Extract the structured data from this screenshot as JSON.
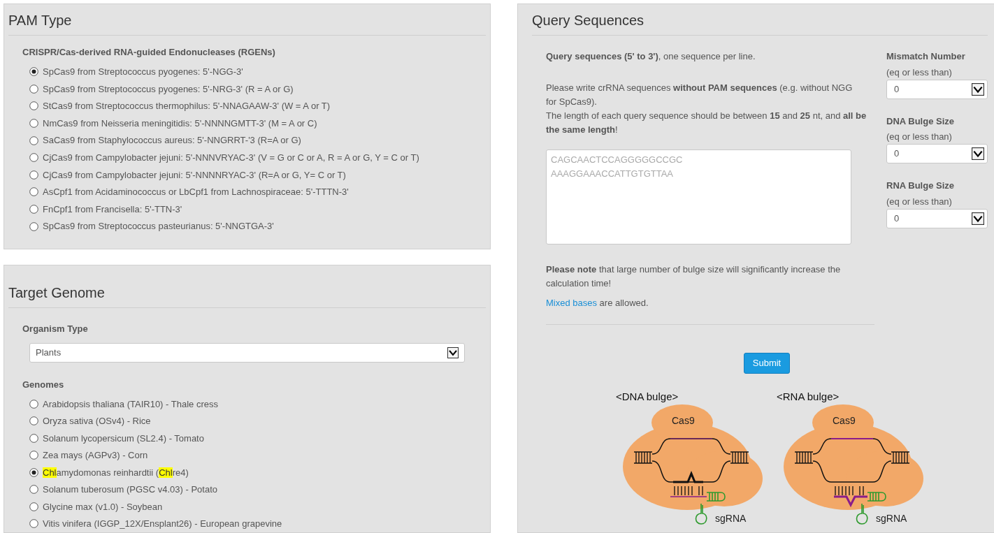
{
  "pam_type": {
    "title": "PAM Type",
    "group_label": "CRISPR/Cas-derived RNA-guided Endonucleases (RGENs)",
    "options": [
      {
        "label": "SpCas9 from Streptococcus pyogenes: 5'-NGG-3'",
        "selected": true
      },
      {
        "label": "SpCas9 from Streptococcus pyogenes: 5'-NRG-3' (R = A or G)",
        "selected": false
      },
      {
        "label": "StCas9 from Streptococcus thermophilus: 5'-NNAGAAW-3' (W = A or T)",
        "selected": false
      },
      {
        "label": "NmCas9 from Neisseria meningitidis: 5'-NNNNGMTT-3' (M = A or C)",
        "selected": false
      },
      {
        "label": "SaCas9 from Staphylococcus aureus: 5'-NNGRRT-'3 (R=A or G)",
        "selected": false
      },
      {
        "label": "CjCas9 from Campylobacter jejuni: 5'-NNNVRYAC-3' (V = G or C or A, R = A or G, Y = C or T)",
        "selected": false
      },
      {
        "label": "CjCas9 from Campylobacter jejuni: 5'-NNNNRYAC-3' (R=A or G, Y= C or T)",
        "selected": false
      },
      {
        "label": "AsCpf1 from Acidaminococcus or LbCpf1 from Lachnospiraceae: 5'-TTTN-3'",
        "selected": false
      },
      {
        "label": "FnCpf1 from Francisella: 5'-TTN-3'",
        "selected": false
      },
      {
        "label": "SpCas9 from Streptococcus pasteurianus: 5'-NNGTGA-3'",
        "selected": false
      }
    ]
  },
  "target_genome": {
    "title": "Target Genome",
    "organism_label": "Organism Type",
    "organism_value": "Plants",
    "genomes_label": "Genomes",
    "genomes": [
      {
        "parts": [
          {
            "text": "Arabidopsis thaliana (TAIR10) - Thale cress",
            "highlight": false
          }
        ],
        "selected": false
      },
      {
        "parts": [
          {
            "text": "Oryza sativa (OSv4) - Rice",
            "highlight": false
          }
        ],
        "selected": false
      },
      {
        "parts": [
          {
            "text": "Solanum lycopersicum (SL2.4) - Tomato",
            "highlight": false
          }
        ],
        "selected": false
      },
      {
        "parts": [
          {
            "text": "Zea mays (AGPv3) - Corn",
            "highlight": false
          }
        ],
        "selected": false
      },
      {
        "parts": [
          {
            "text": "Chl",
            "highlight": true
          },
          {
            "text": "amydomonas reinhardtii (",
            "highlight": false
          },
          {
            "text": "Chl",
            "highlight": true
          },
          {
            "text": "re4)",
            "highlight": false
          }
        ],
        "selected": true
      },
      {
        "parts": [
          {
            "text": "Solanum tuberosum (PGSC v4.03) - Potato",
            "highlight": false
          }
        ],
        "selected": false
      },
      {
        "parts": [
          {
            "text": "Glycine max (v1.0) - Soybean",
            "highlight": false
          }
        ],
        "selected": false
      },
      {
        "parts": [
          {
            "text": "Vitis vinifera (IGGP_12X/Ensplant26) - European grapevine",
            "highlight": false
          }
        ],
        "selected": false
      }
    ]
  },
  "query": {
    "title": "Query Sequences",
    "intro": "**Query sequences (5' to 3')**, one sequence per line.",
    "instructions": "Please write crRNA sequences **without PAM sequences** (e.g. without NGG for SpCas9).",
    "length_rule": "The length of each query sequence should be between **15** and **25** nt, and **all be the same length**!",
    "placeholder": "CAGCAACTCCAGGGGGCCGC\nAAAGGAAACCATTGTGTTAA",
    "note": "**Please note** that large number of bulge size will significantly increase the calculation time!",
    "mixed_link": "Mixed bases",
    "mixed_rest": " are allowed.",
    "submit": "Submit",
    "settings": [
      {
        "label": "Mismatch Number",
        "hint": "(eq or less than)",
        "value": "0"
      },
      {
        "label": "DNA Bulge Size",
        "hint": "(eq or less than)",
        "value": "0"
      },
      {
        "label": "RNA Bulge Size",
        "hint": "(eq or less than)",
        "value": "0"
      }
    ],
    "diagrams": [
      {
        "kind": "dna",
        "title": "<DNA bulge>",
        "protein": "Cas9",
        "guide": "sgRNA"
      },
      {
        "kind": "rna",
        "title": "<RNA bulge>",
        "protein": "Cas9",
        "guide": "sgRNA"
      }
    ]
  }
}
